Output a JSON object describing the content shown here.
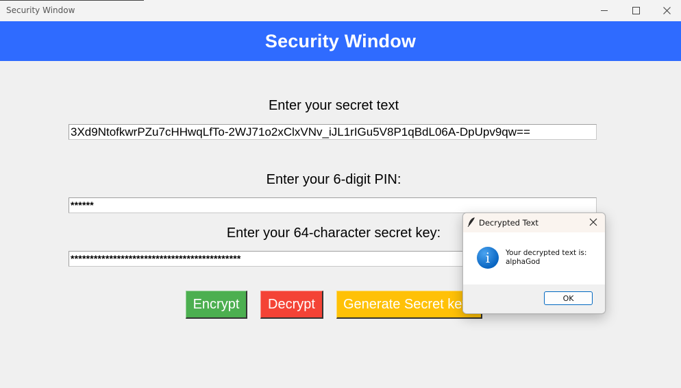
{
  "window": {
    "title": "Security Window"
  },
  "header": {
    "title": "Security Window",
    "color": "#2f6bff"
  },
  "form": {
    "secret_text_label": "Enter your secret text",
    "secret_text_value": "3Xd9NtofkwrPZu7cHHwqLfTo-2WJ71o2xClxVNv_iJL1rIGu5V8P1qBdL06A-DpUpv9qw==",
    "pin_label": "Enter your 6-digit PIN:",
    "pin_value": "******",
    "key_label": "Enter your 64-character secret key:",
    "key_value": "********************************************"
  },
  "buttons": {
    "encrypt": {
      "label": "Encrypt",
      "color": "#4caf50"
    },
    "decrypt": {
      "label": "Decrypt",
      "color": "#f44336"
    },
    "generate": {
      "label": "Generate Secret key",
      "color": "#ffc107"
    }
  },
  "dialog": {
    "title": "Decrypted Text",
    "icon": "info-icon",
    "icon_glyph": "i",
    "message_line1": "Your decrypted text is:",
    "message_line2": "alphaGod",
    "ok_label": "OK"
  }
}
